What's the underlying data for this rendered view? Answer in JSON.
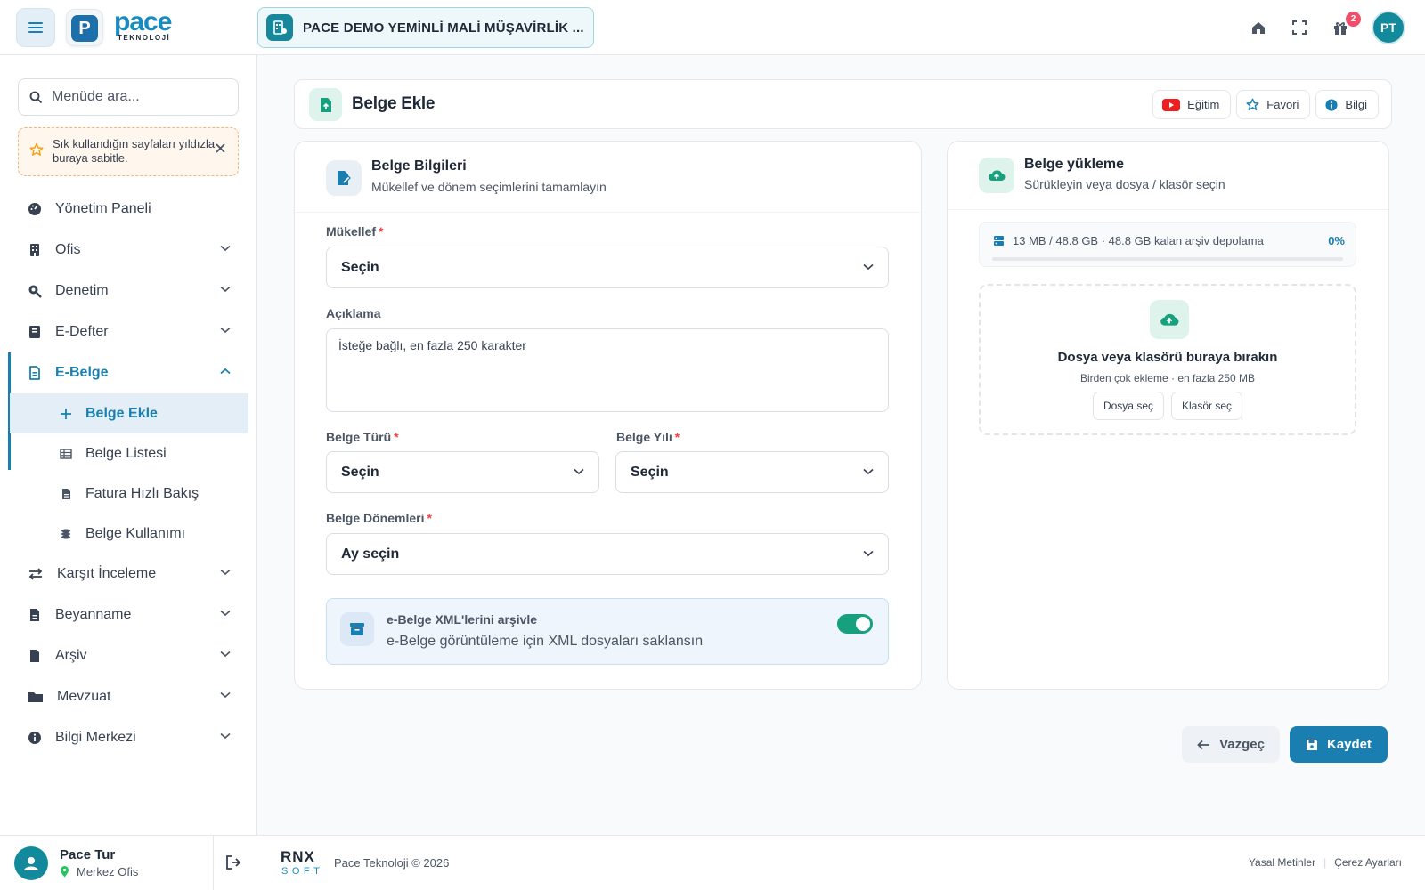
{
  "brand": {
    "logo_letter": "P",
    "wordmark": "pace",
    "sub": "TEKNOLOJİ"
  },
  "header": {
    "company_name": "PACE DEMO YEMİNLİ MALİ MÜŞAVİRLİK ...",
    "notification_count": "2",
    "avatar_initials": "PT"
  },
  "sidebar": {
    "search_placeholder": "Menüde ara...",
    "tip": "Sık kullandığın sayfaları yıldızla buraya sabitle.",
    "items": [
      {
        "label": "Yönetim Paneli",
        "icon": "dashboard-icon",
        "expandable": false
      },
      {
        "label": "Ofis",
        "icon": "building-icon",
        "expandable": true
      },
      {
        "label": "Denetim",
        "icon": "search-magnify-icon",
        "expandable": true
      },
      {
        "label": "E-Defter",
        "icon": "book-icon",
        "expandable": true
      },
      {
        "label": "E-Belge",
        "icon": "document-icon",
        "expandable": true,
        "expanded": true
      },
      {
        "label": "Karşıt İnceleme",
        "icon": "exchange-icon",
        "expandable": true
      },
      {
        "label": "Beyanname",
        "icon": "file-icon",
        "expandable": true
      },
      {
        "label": "Arşiv",
        "icon": "archive-file-icon",
        "expandable": true
      },
      {
        "label": "Mevzuat",
        "icon": "folder-icon",
        "expandable": true
      },
      {
        "label": "Bilgi Merkezi",
        "icon": "info-icon",
        "expandable": true
      }
    ],
    "sub_items": [
      {
        "label": "Belge Ekle",
        "icon": "plus-icon",
        "current": true
      },
      {
        "label": "Belge Listesi",
        "icon": "table-icon"
      },
      {
        "label": "Fatura Hızlı Bakış",
        "icon": "file-icon"
      },
      {
        "label": "Belge Kullanımı",
        "icon": "coins-icon"
      }
    ],
    "user": {
      "name": "Pace Tur",
      "office": "Merkez Ofis"
    }
  },
  "page": {
    "title": "Belge Ekle",
    "buttons": {
      "training": "Eğitim",
      "favorite": "Favori",
      "info": "Bilgi"
    }
  },
  "form": {
    "title": "Belge Bilgileri",
    "subtitle": "Mükellef ve dönem seçimlerini tamamlayın",
    "mukellef_label": "Mükellef",
    "mukellef_value": "Seçin",
    "aciklama_label": "Açıklama",
    "aciklama_placeholder": "İsteğe bağlı, en fazla 250 karakter",
    "belge_turu_label": "Belge Türü",
    "belge_turu_value": "Seçin",
    "belge_yili_label": "Belge Yılı",
    "belge_yili_value": "Seçin",
    "donem_label": "Belge Dönemleri",
    "donem_value": "Ay seçin",
    "required_mark": "*",
    "archive_title": "e-Belge XML'lerini arşivle",
    "archive_sub": "e-Belge görüntüleme için XML dosyaları saklansın",
    "archive_enabled": true
  },
  "upload": {
    "title": "Belge yükleme",
    "subtitle": "Sürükleyin veya dosya / klasör seçin",
    "storage_text": "13 MB / 48.8 GB · 48.8 GB kalan arşiv depolama",
    "storage_percent": "0%",
    "storage_fraction": 0,
    "drop_title": "Dosya veya klasörü buraya bırakın",
    "drop_sub": "Birden çok ekleme · en fazla 250 MB",
    "choose_file": "Dosya seç",
    "choose_folder": "Klasör seç"
  },
  "actions": {
    "cancel": "Vazgeç",
    "save": "Kaydet"
  },
  "footer": {
    "logo_top": "RNX",
    "logo_bottom": "SOFT",
    "copyright": "Pace Teknoloji © 2026",
    "links": [
      "Yasal Metinler",
      "Çerez Ayarları"
    ]
  },
  "colors": {
    "primary": "#1a7fb0",
    "teal": "#138a9c",
    "green": "#17a07e",
    "danger": "#ef4444"
  }
}
